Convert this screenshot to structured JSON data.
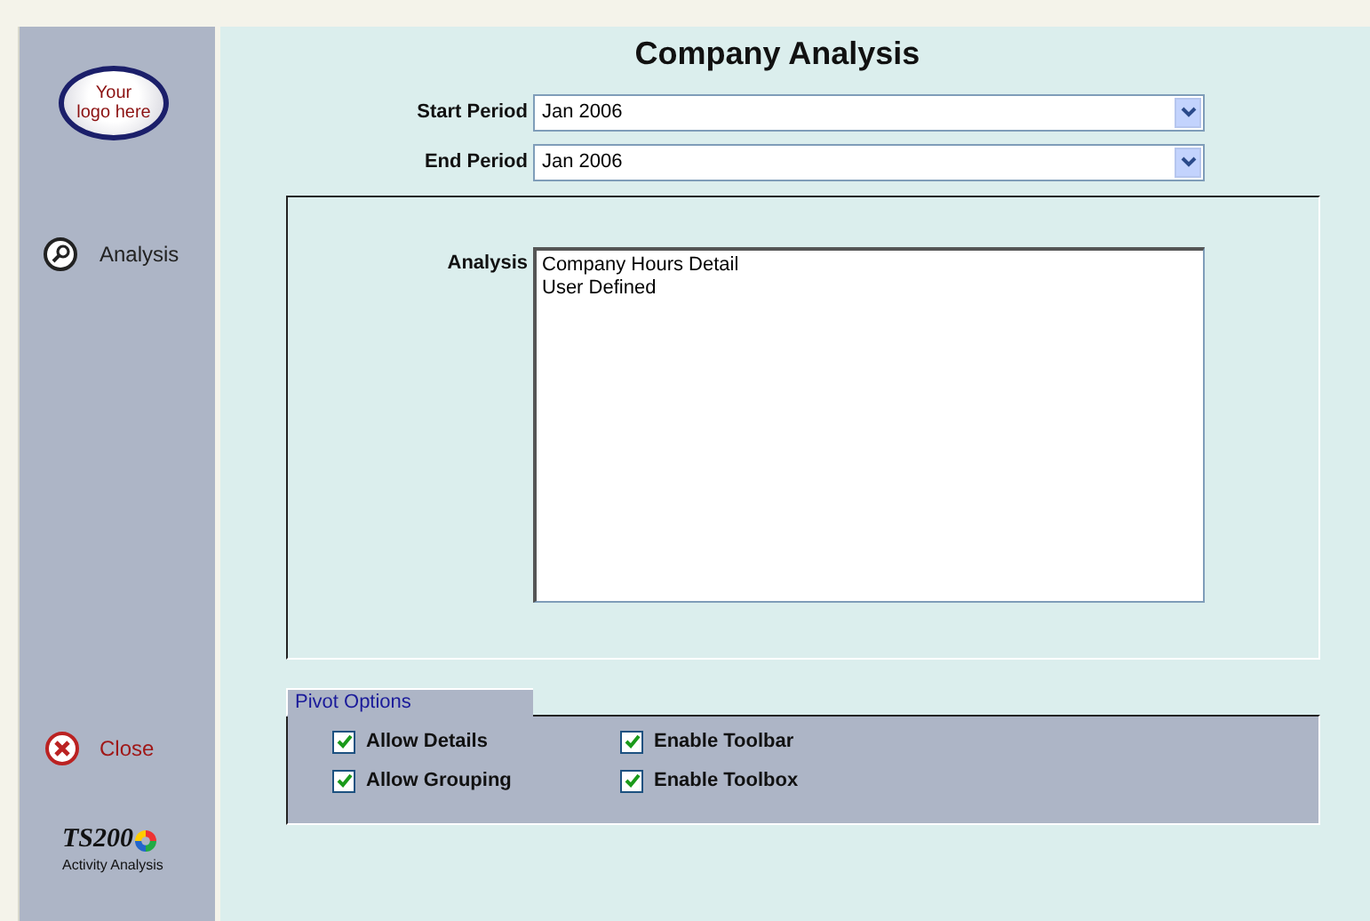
{
  "sidebar": {
    "logo": {
      "lines": [
        "Your",
        "logo here"
      ]
    },
    "nav_items": [
      {
        "label": "Analysis",
        "kind": "search"
      }
    ],
    "close": {
      "label": "Close"
    },
    "brand": {
      "name": "TS200",
      "subtitle": "Activity Analysis"
    }
  },
  "main": {
    "title": "Company Analysis",
    "periods": [
      {
        "label": "Start Period",
        "value": "Jan 2006"
      },
      {
        "label": "End Period",
        "value": "Jan 2006"
      }
    ],
    "analysis": {
      "label": "Analysis",
      "items": [
        {
          "label": "Company Hours Detail",
          "selected": false
        },
        {
          "label": "User Defined",
          "selected": false
        }
      ]
    },
    "pivot_options": {
      "title": "Pivot Options",
      "options": [
        {
          "label": "Allow Details",
          "checked": true
        },
        {
          "label": "Allow Grouping",
          "checked": true
        },
        {
          "label": "Enable Toolbar",
          "checked": true
        },
        {
          "label": "Enable Toolbox",
          "checked": true
        }
      ]
    }
  }
}
